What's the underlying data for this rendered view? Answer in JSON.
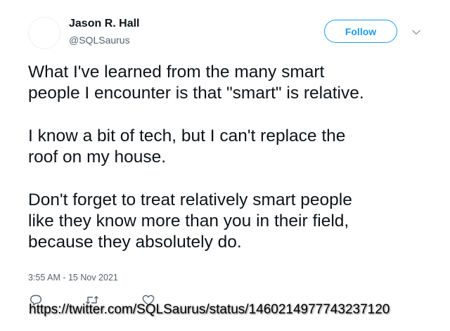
{
  "author": {
    "name": "Jason R. Hall",
    "handle": "@SQLSaurus"
  },
  "follow_button": {
    "label": "Follow"
  },
  "more_button": {
    "icon": "chevron-down-icon"
  },
  "tweet": {
    "paragraphs": [
      {
        "lines": [
          "What I've learned from the many smart",
          "people I encounter is that \"smart\" is relative."
        ]
      },
      {
        "lines": [
          "I know a bit of tech, but I can't replace the",
          "roof on my house."
        ]
      },
      {
        "lines": [
          "Don't forget to treat relatively smart people",
          "like they know more than you in their field,",
          "because they absolutely do."
        ]
      }
    ],
    "timestamp": "3:55 AM - 15 Nov 2021"
  },
  "actions": [
    {
      "icon": "reply-icon"
    },
    {
      "icon": "retweet-icon"
    },
    {
      "icon": "like-icon"
    }
  ],
  "overlay": {
    "url": "https://twitter.com/SQLSaurus/status/1460214977743237120"
  },
  "colors": {
    "accent": "#1d9bf0",
    "text": "#0f1419",
    "muted": "#536471"
  }
}
